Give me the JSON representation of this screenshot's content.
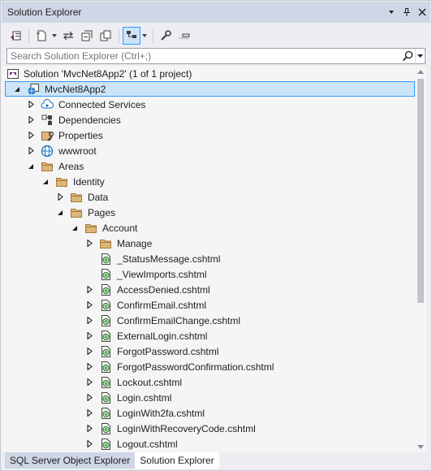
{
  "window": {
    "title": "Solution Explorer"
  },
  "toolbar": {
    "buttons": [
      {
        "name": "switch-views-icon"
      },
      {
        "name": "pending-changes-filter-icon"
      },
      {
        "name": "sync-active-document-icon"
      },
      {
        "name": "refresh-icon"
      },
      {
        "name": "collapse-all-icon"
      },
      {
        "name": "show-all-files-icon",
        "selected": true
      },
      {
        "name": "properties-wrench-icon"
      },
      {
        "name": "preview-selected-icon"
      }
    ]
  },
  "search": {
    "placeholder": "Search Solution Explorer (Ctrl+;)",
    "value": ""
  },
  "tree": [
    {
      "label": "Solution 'MvcNet8App2' (1 of 1 project)",
      "depth": 0,
      "expander": "none",
      "icon": "solution-icon"
    },
    {
      "label": "MvcNet8App2",
      "depth": 0,
      "expander": "expanded",
      "icon": "web-project-icon",
      "selected": true,
      "bold": true
    },
    {
      "label": "Connected Services",
      "depth": 1,
      "expander": "collapsed",
      "icon": "connected-services-icon"
    },
    {
      "label": "Dependencies",
      "depth": 1,
      "expander": "collapsed",
      "icon": "dependencies-icon"
    },
    {
      "label": "Properties",
      "depth": 1,
      "expander": "collapsed",
      "icon": "properties-icon"
    },
    {
      "label": "wwwroot",
      "depth": 1,
      "expander": "collapsed",
      "icon": "globe-icon"
    },
    {
      "label": "Areas",
      "depth": 1,
      "expander": "expanded",
      "icon": "folder-icon"
    },
    {
      "label": "Identity",
      "depth": 2,
      "expander": "expanded",
      "icon": "folder-icon"
    },
    {
      "label": "Data",
      "depth": 3,
      "expander": "collapsed",
      "icon": "folder-icon"
    },
    {
      "label": "Pages",
      "depth": 3,
      "expander": "expanded",
      "icon": "folder-icon"
    },
    {
      "label": "Account",
      "depth": 4,
      "expander": "expanded",
      "icon": "folder-icon"
    },
    {
      "label": "Manage",
      "depth": 5,
      "expander": "collapsed",
      "icon": "folder-icon"
    },
    {
      "label": "_StatusMessage.cshtml",
      "depth": 5,
      "expander": "none",
      "icon": "razor-file-icon"
    },
    {
      "label": "_ViewImports.cshtml",
      "depth": 5,
      "expander": "none",
      "icon": "razor-file-icon"
    },
    {
      "label": "AccessDenied.cshtml",
      "depth": 5,
      "expander": "collapsed",
      "icon": "razor-file-icon"
    },
    {
      "label": "ConfirmEmail.cshtml",
      "depth": 5,
      "expander": "collapsed",
      "icon": "razor-file-icon"
    },
    {
      "label": "ConfirmEmailChange.cshtml",
      "depth": 5,
      "expander": "collapsed",
      "icon": "razor-file-icon"
    },
    {
      "label": "ExternalLogin.cshtml",
      "depth": 5,
      "expander": "collapsed",
      "icon": "razor-file-icon"
    },
    {
      "label": "ForgotPassword.cshtml",
      "depth": 5,
      "expander": "collapsed",
      "icon": "razor-file-icon"
    },
    {
      "label": "ForgotPasswordConfirmation.cshtml",
      "depth": 5,
      "expander": "collapsed",
      "icon": "razor-file-icon"
    },
    {
      "label": "Lockout.cshtml",
      "depth": 5,
      "expander": "collapsed",
      "icon": "razor-file-icon"
    },
    {
      "label": "Login.cshtml",
      "depth": 5,
      "expander": "collapsed",
      "icon": "razor-file-icon"
    },
    {
      "label": "LoginWith2fa.cshtml",
      "depth": 5,
      "expander": "collapsed",
      "icon": "razor-file-icon"
    },
    {
      "label": "LoginWithRecoveryCode.cshtml",
      "depth": 5,
      "expander": "collapsed",
      "icon": "razor-file-icon"
    },
    {
      "label": "Logout.cshtml",
      "depth": 5,
      "expander": "collapsed",
      "icon": "razor-file-icon"
    }
  ],
  "tabs": [
    {
      "label": "SQL Server Object Explorer",
      "active": false
    },
    {
      "label": "Solution Explorer",
      "active": true
    }
  ],
  "colors": {
    "accent": "#3399ff",
    "selection": "#cce4f7",
    "titlebar": "#cfd6e5",
    "razor_green": "#388a34",
    "folder": "#dcb67a"
  }
}
